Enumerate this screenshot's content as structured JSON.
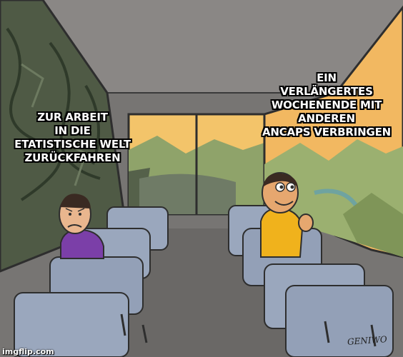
{
  "captions": {
    "left": "ZUR ARBEIT\nIN DIE\nETATISTISCHE WELT\nZURÜCKFAHREN",
    "right": "EIN\nVERLÄNGERTES\nWOCHENENDE MIT\nANDEREN\nANCAPS VERBRINGEN"
  },
  "watermark": "imgflip.com",
  "signature": "GENIWO",
  "colors": {
    "bus_interior": "#7a7876",
    "seat": "#9aa7bd",
    "rock_window": "#4f5a45",
    "sunset_sky": "#f3c46a",
    "mountains": "#8fa36a",
    "sad_shirt": "#7b3fa8",
    "happy_shirt": "#f0b21c",
    "caption_text": "#ffffff",
    "caption_outline": "#000000"
  }
}
